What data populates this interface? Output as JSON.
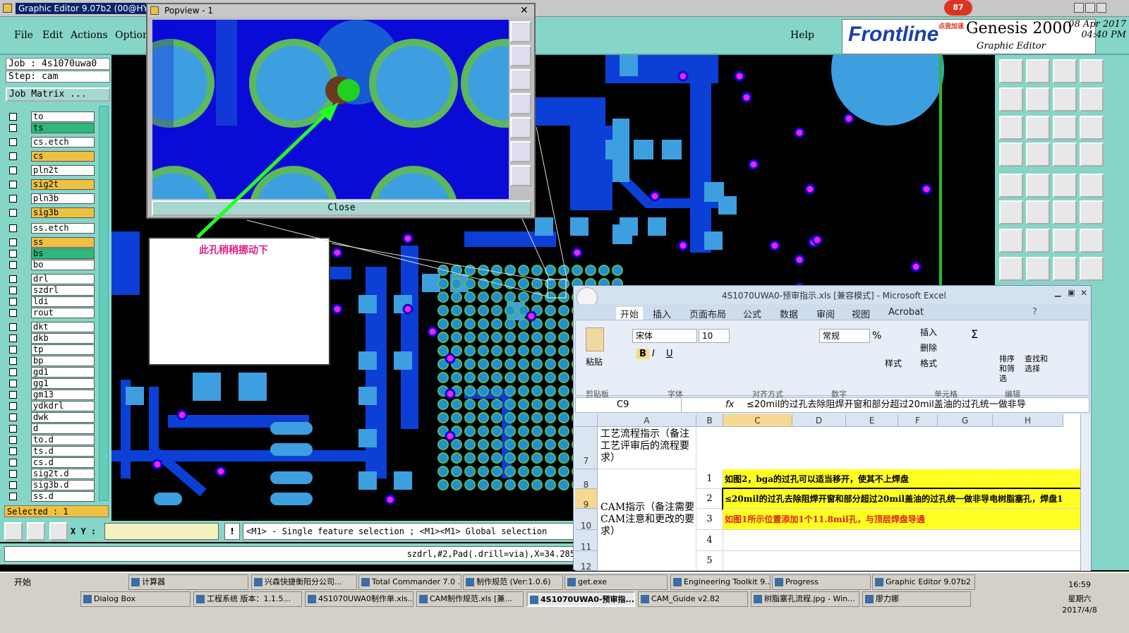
{
  "genesis": {
    "title": "Graphic Editor 9.07b2 (00@HY-HY",
    "menu": [
      "File",
      "Edit",
      "Actions",
      "Options"
    ],
    "help": "Help",
    "logo": "Frontline",
    "product": "Genesis 2000",
    "subtitle": "Graphic Editor",
    "date": "08 Apr 2017",
    "time": "04:40 PM",
    "badge": "87",
    "badge_note": "点我加速",
    "job": "Job : 4s1070uwa0",
    "step": "Step: cam",
    "job_matrix": "Job Matrix ...",
    "layers": [
      {
        "name": "to",
        "color": "#ffffff"
      },
      {
        "name": "ts",
        "color": "#2eb87a"
      },
      {
        "name": "cs.etch",
        "color": "#ffffff"
      },
      {
        "name": "cs",
        "color": "#f0c040"
      },
      {
        "name": "pln2t",
        "color": "#ffffff"
      },
      {
        "name": "sig2t",
        "color": "#f0c040"
      },
      {
        "name": "pln3b",
        "color": "#ffffff"
      },
      {
        "name": "sig3b",
        "color": "#f0c040"
      },
      {
        "name": "ss.etch",
        "color": "#ffffff"
      },
      {
        "name": "ss",
        "color": "#f0c040"
      },
      {
        "name": "bs",
        "color": "#2eb87a"
      },
      {
        "name": "bo",
        "color": "#ffffff"
      },
      {
        "name": "drl",
        "color": "#ffffff"
      },
      {
        "name": "szdrl",
        "color": "#ffffff"
      },
      {
        "name": "ldi",
        "color": "#ffffff"
      },
      {
        "name": "rout",
        "color": "#ffffff"
      },
      {
        "name": "dkt",
        "color": "#ffffff"
      },
      {
        "name": "dkb",
        "color": "#ffffff"
      },
      {
        "name": "tp",
        "color": "#ffffff"
      },
      {
        "name": "bp",
        "color": "#ffffff"
      },
      {
        "name": "gd1",
        "color": "#ffffff"
      },
      {
        "name": "gg1",
        "color": "#ffffff"
      },
      {
        "name": "gm13",
        "color": "#ffffff"
      },
      {
        "name": "ydkdrl",
        "color": "#ffffff"
      },
      {
        "name": "dwk",
        "color": "#ffffff"
      },
      {
        "name": "d",
        "color": "#ffffff"
      },
      {
        "name": "to.d",
        "color": "#ffffff"
      },
      {
        "name": "ts.d",
        "color": "#ffffff"
      },
      {
        "name": "cs.d",
        "color": "#ffffff"
      },
      {
        "name": "sig2t.d",
        "color": "#ffffff"
      },
      {
        "name": "sig3b.d",
        "color": "#ffffff"
      },
      {
        "name": "ss.d",
        "color": "#ffffff"
      }
    ],
    "selected": "Selected : 1",
    "xy_label": "X Y :",
    "hint": "<M1> - Single feature selection ; <M1><M1> Global selection",
    "status": "szdrl,#2,Pad(.drill=via),X=34.285"
  },
  "popview": {
    "title": "Popview - 1",
    "close": "Close",
    "close_x": "✕"
  },
  "note": {
    "text": "此孔稍稍挪动下"
  },
  "excel": {
    "title": "4S1070UWA0-预审指示.xls [兼容模式] - Microsoft Excel",
    "tabs": [
      "开始",
      "插入",
      "页面布局",
      "公式",
      "数据",
      "审阅",
      "视图",
      "Acrobat"
    ],
    "font": "宋体",
    "size": "10",
    "numfmt": "常规",
    "groups": [
      "剪贴板",
      "字体",
      "对齐方式",
      "数字",
      "单元格",
      "编辑"
    ],
    "paste": "粘贴",
    "style": "样式",
    "insert": "插入",
    "delete": "删除",
    "format": "格式",
    "sort": "排序和筛选",
    "find": "查找和选择",
    "namebox": "C9",
    "formula": "≤20mil的过孔去除阻焊开窗和部分超过20mil盖油的过孔统一做非导",
    "cols": [
      "A",
      "B",
      "C",
      "D",
      "E",
      "F",
      "G",
      "H"
    ],
    "rows": [
      "7",
      "8",
      "9",
      "10",
      "11",
      "12"
    ],
    "a7": "工艺流程指示（备注工艺评审后的流程要求）",
    "a10": "CAM指示（备注需要CAM注意和更改的要求）",
    "b": [
      "1",
      "2",
      "3",
      "4",
      "5"
    ],
    "c": [
      "如图2，bga的过孔可以适当移开，使其不上焊盘",
      "≤20mil的过孔去除阻焊开窗和部分超过20mil盖油的过孔统一做非导电树脂塞孔，焊盘1",
      "如图1所示位置添加1个11.8mil孔，与顶层焊盘导通",
      "",
      ""
    ]
  },
  "taskbar": {
    "start": "开始",
    "row1": [
      "计算器",
      "兴森快捷衡阳分公司...",
      "Total Commander 7.0 ...",
      "制作规范 (Ver:1.0.6)",
      "get.exe",
      "Engineering Toolkit 9....",
      "Progress",
      "Graphic Editor 9.07b2 ..."
    ],
    "row2": [
      "Dialog Box",
      "工程系统  版本：1.1.5...",
      "4S1070UWA0制作单.xls...",
      "CAM制作规范.xls [兼...",
      "4S1070UWA0-预审指...",
      "CAM_Guide v2.82",
      "树脂塞孔流程.jpg - Win...",
      "廖力娜"
    ],
    "clock": "16:59",
    "weekday": "星期六",
    "date": "2017/4/8"
  }
}
